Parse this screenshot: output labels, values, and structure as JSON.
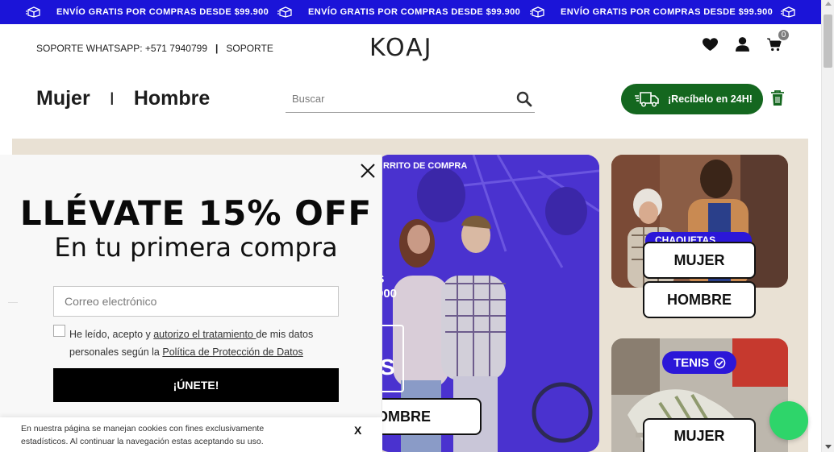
{
  "promo": {
    "text": "ENVÍO GRATIS POR COMPRAS DESDE $99.900"
  },
  "header": {
    "support_whatsapp": "SOPORTE WHATSAPP: +571 7940799",
    "separator": "|",
    "support_link": "SOPORTE",
    "logo": "KOAJ",
    "cart_count": "0"
  },
  "nav": {
    "women": "Mujer",
    "separator": "I",
    "men": "Hombre"
  },
  "search": {
    "placeholder": "Buscar"
  },
  "express": {
    "label": "¡Recíbelo en 24H!"
  },
  "hero": {
    "top_text": "RRITO DE COMPRA",
    "price_line1": "S",
    "price_line2": "000",
    "big_letter": "S",
    "button": "OMBRE"
  },
  "cards": {
    "chip1": "CHAQUETAS",
    "chip2": "TENIS",
    "mujer": "MUJER",
    "hombre": "HOMBRE",
    "mujer2": "MUJER"
  },
  "popup": {
    "title": "LLÉVATE 15% OFF",
    "subtitle": "En tu primera compra",
    "email_placeholder": "Correo electrónico",
    "consent_part1": "He leído, acepto y ",
    "consent_link1": "autorizo el tratamiento ",
    "consent_part2": "de mis datos personales según la ",
    "consent_link2": "Política de Protección de Datos",
    "join": "¡ÚNETE!"
  },
  "cookie": {
    "text": "En nuestra página se manejan cookies con fines exclusivamente estadísticos. Al continuar la navegación estas aceptando su uso.",
    "close": "X"
  },
  "colors": {
    "promo_bg": "#1b14d8",
    "express_bg": "#14671f",
    "banner_bg": "#e9e1d4",
    "chat": "#2ed56a"
  }
}
